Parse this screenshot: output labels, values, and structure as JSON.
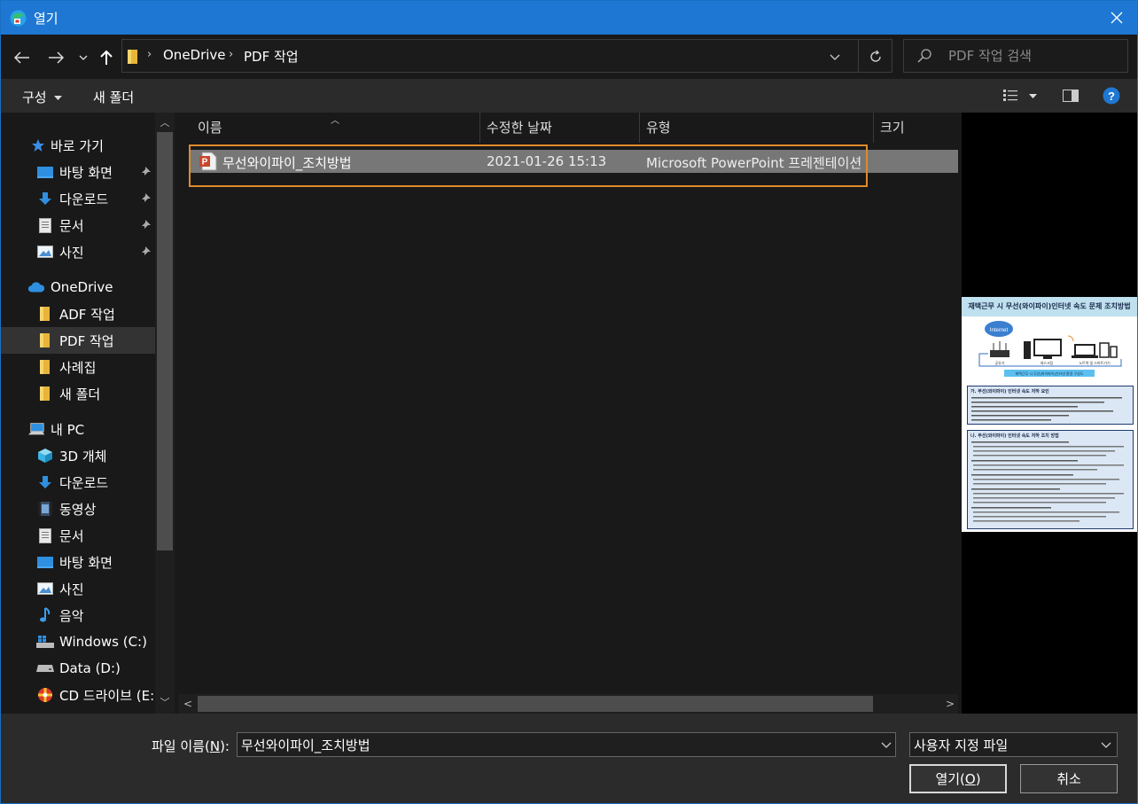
{
  "window": {
    "title": "열기",
    "accent": "#1e77d2",
    "focus_color": "#e08a2c"
  },
  "address": {
    "crumbs": [
      "OneDrive",
      "PDF 작업"
    ],
    "search_placeholder": "PDF 작업 검색"
  },
  "toolbar": {
    "organize_label": "구성",
    "new_folder_label": "새 폴더"
  },
  "nav": {
    "quick_access": "바로 가기",
    "quick_items": [
      "바탕 화면",
      "다운로드",
      "문서",
      "사진"
    ],
    "onedrive": "OneDrive",
    "onedrive_items": [
      "ADF 작업",
      "PDF 작업",
      "사례집",
      "새 폴더"
    ],
    "this_pc": "내 PC",
    "pc_items": [
      "3D 개체",
      "다운로드",
      "동영상",
      "문서",
      "바탕 화면",
      "사진",
      "음악",
      "Windows (C:)",
      "Data (D:)",
      "CD 드라이브 (E:)"
    ]
  },
  "columns": {
    "name": "이름",
    "date": "수정한 날짜",
    "type": "유형",
    "size": "크기"
  },
  "files": [
    {
      "name": "무선와이파이_조치방법",
      "date": "2021-01-26 15:13",
      "type": "Microsoft PowerPoint 프레젠테이션",
      "icon": "powerpoint-icon"
    }
  ],
  "preview": {
    "slide_title": "재택근무 시 무선(와이파이)인터넷 속도 문제 조치방법",
    "cloud_label": "Internet",
    "device_labels": [
      "공유기",
      "데스크탑",
      "노트북 및 스마트기기"
    ],
    "caption": "재택근무 시 무선(와이파이)인터넷 환경 구성도",
    "section1_title": "가. 무선(와이파이) 인터넷 속도 저하 요인",
    "section2_title": "나. 무선(와이파이) 인터넷 속도 저하 조치 방법"
  },
  "footer": {
    "filename_label": "파일 이름(",
    "filename_mnemonic": "N",
    "filename_label_end": "):",
    "filename_value": "무선와이파이_조치방법",
    "filetype_value": "사용자 지정 파일",
    "open_label": "열기(",
    "open_mnemonic": "O",
    "open_label_end": ")",
    "cancel_label": "취소"
  }
}
